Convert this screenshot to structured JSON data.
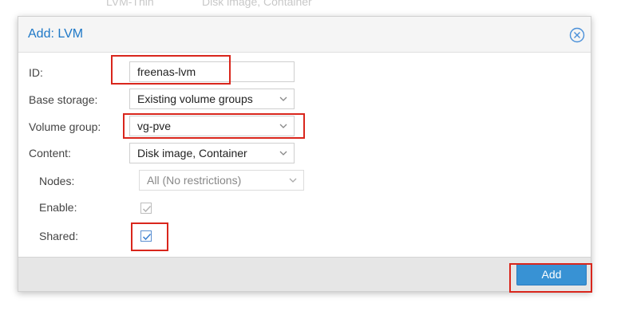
{
  "background": {
    "col1": "LVM-Thin",
    "col2": "Disk image, Container"
  },
  "dialog": {
    "title": "Add: LVM",
    "close_icon": "close-circle-icon",
    "fields": {
      "id_label": "ID:",
      "id_value": "freenas-lvm",
      "base_storage_label": "Base storage:",
      "base_storage_value": "Existing volume groups",
      "volume_group_label": "Volume group:",
      "volume_group_value": "vg-pve",
      "content_label": "Content:",
      "content_value": "Disk image, Container",
      "nodes_label": "Nodes:",
      "nodes_value": "All (No restrictions)",
      "enable_label": "Enable:",
      "enable_checked": true,
      "shared_label": "Shared:",
      "shared_checked": true
    },
    "add_label": "Add"
  },
  "colors": {
    "accent": "#1e78c7",
    "button": "#3892d4",
    "highlight": "#d9261c"
  }
}
